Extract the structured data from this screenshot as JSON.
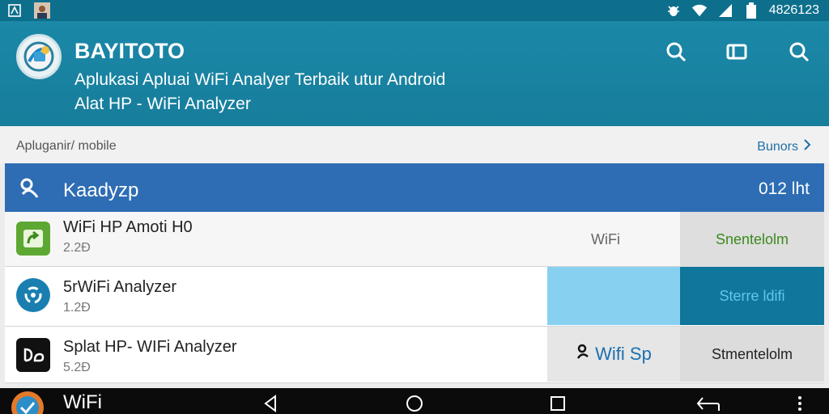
{
  "status_bar": {
    "left_icons": [
      "notification-icon",
      "user-avatar-icon"
    ],
    "right_icons": [
      "bug-icon",
      "wifi-signal-icon",
      "cellular-signal-icon",
      "battery-icon"
    ],
    "time": "4826123"
  },
  "app_bar": {
    "title": "BAYITOTO",
    "subtitle_line1": "Aplukasi Apluai WiFi Analyer Terbaik utur Android",
    "subtitle_line2": "Alat HP - WiFi Analyzer",
    "actions": [
      "search-icon",
      "tablet-icon",
      "search-icon"
    ],
    "colors": {
      "bar": "#1b88a8",
      "status": "#0d6f8c"
    }
  },
  "section": {
    "label": "Apluganir/ mobile",
    "link": "Bunors"
  },
  "list_header": {
    "title": "Kaadyzp",
    "right_text": "012 lht",
    "color": "#2e6db4"
  },
  "apps": [
    {
      "name": "WiFi HP Amoti H0",
      "version": "2.2Ð",
      "tag": "WiFi",
      "button": "Snentelolm",
      "icon": "green-arrow-icon"
    },
    {
      "name": "5rWiFi Analyzer",
      "version": "1.2Ð",
      "button": "Sterre ldifi",
      "icon": "blue-circle-icon"
    },
    {
      "name": "Splat HP- WIFi Analyzer",
      "version": "5.2Ð",
      "chip": "Wifi Sp",
      "button": "Stmentelolm",
      "icon": "black-app-icon"
    }
  ],
  "nav_bar": {
    "label": "WiFi",
    "buttons": [
      "back-icon",
      "home-icon",
      "recents-icon",
      "rotate-icon",
      "more-icon"
    ]
  }
}
